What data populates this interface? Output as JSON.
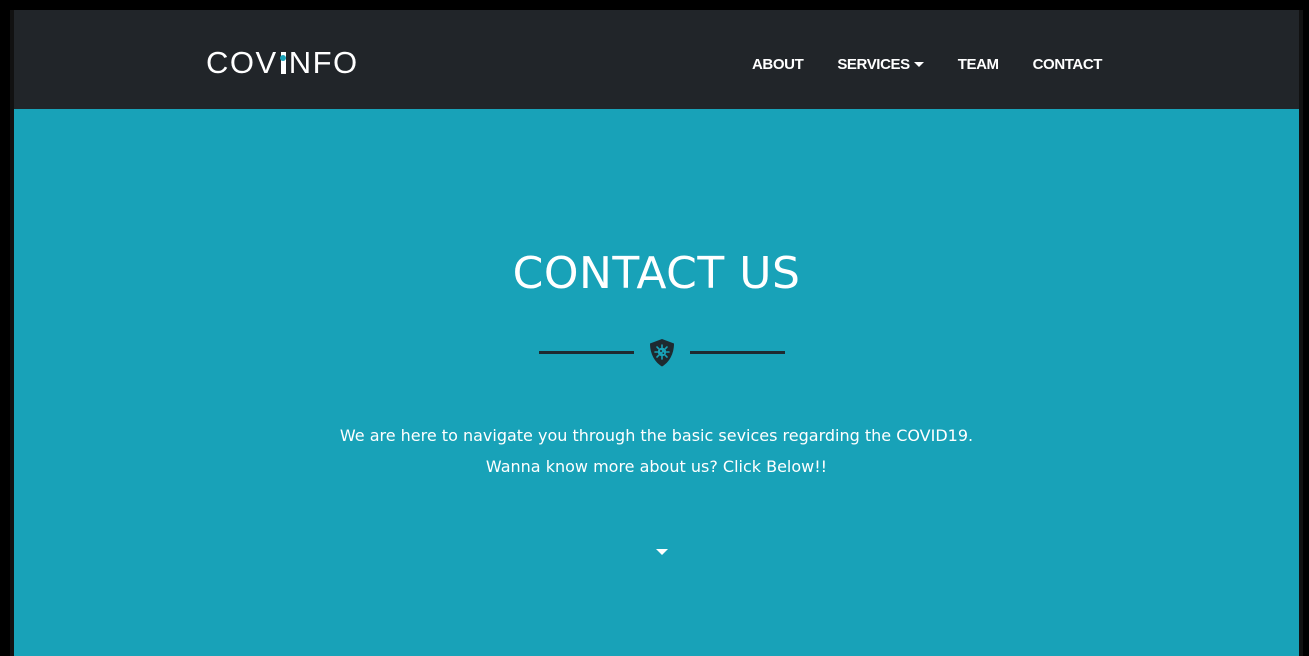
{
  "navbar": {
    "brand": {
      "prefix": "COV",
      "suffix": "NFO"
    },
    "links": [
      {
        "label": "ABOUT",
        "icon": ""
      },
      {
        "label": "SERVICES",
        "icon": "caret-down-icon"
      },
      {
        "label": "TEAM",
        "icon": ""
      },
      {
        "label": "CONTACT",
        "icon": ""
      }
    ]
  },
  "hero": {
    "title": "CONTACT US",
    "divider_icon": "shield-virus-icon",
    "text_line_1": "We are here to navigate you through the basic sevices regarding the COVID19.",
    "text_line_2": "Wanna know more about us? Click Below!!",
    "scroll_icon": "caret-down-icon"
  },
  "colors": {
    "navbar_bg": "#212529",
    "hero_bg": "#18a2b8",
    "divider": "#1e2a30",
    "text": "#ffffff"
  }
}
